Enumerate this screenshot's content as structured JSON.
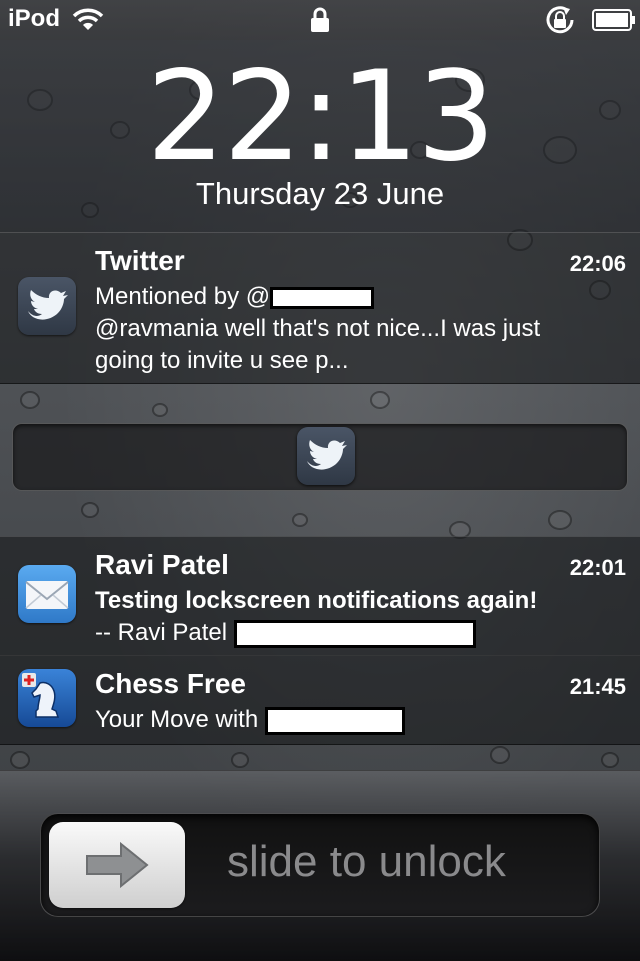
{
  "status_bar": {
    "carrier": "iPod",
    "icons": [
      "wifi-icon",
      "lock-icon",
      "rotation-lock-icon",
      "battery-icon"
    ]
  },
  "lock_clock": {
    "time": "22:13",
    "date": "Thursday 23 June"
  },
  "notifications": [
    {
      "app": "Twitter",
      "icon": "twitter-bird-icon",
      "time": "22:06",
      "lines": [
        "Mentioned by @",
        "@ravmania well that's not nice...I was just",
        "going to invite u see p..."
      ]
    },
    {
      "app": "Ravi Patel",
      "icon": "mail-envelope-icon",
      "time": "22:01",
      "lines": [
        "Testing lockscreen notifications again!",
        "-- Ravi Patel"
      ]
    },
    {
      "app": "Chess Free",
      "icon": "chess-knight-icon",
      "time": "21:45",
      "lines": [
        "Your Move with"
      ]
    }
  ],
  "app_slider": {
    "icon": "twitter-bird-icon"
  },
  "unlock": {
    "label": "slide to unlock",
    "knob_icon": "right-arrow-icon"
  },
  "colors": {
    "twitter_icon_bg": "#3b4453",
    "mail_icon_bg": "#4a9be0",
    "chess_icon_bg": "#1f5fb0",
    "slide_text": "#8a8a8c"
  }
}
